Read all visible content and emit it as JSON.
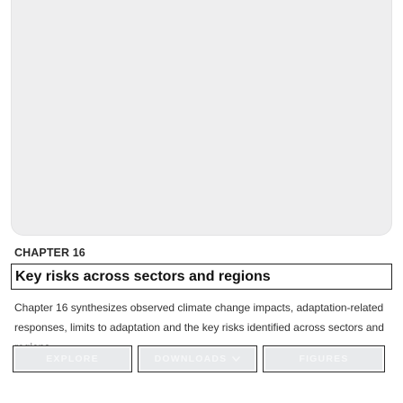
{
  "chapter": {
    "eyebrow": "CHAPTER 16",
    "title": "Key risks across sectors and regions",
    "description": "Chapter 16 synthesizes observed climate change impacts, adaptation-related responses, limits to adaptation and the key risks identified across sectors and regions."
  },
  "actions": {
    "explore_label": "EXPLORE",
    "downloads_label": "DOWNLOADS",
    "figures_label": "FIGURES"
  },
  "icons": {
    "downloads_dropdown": "chevron-down-icon"
  },
  "colors": {
    "hero_background": "#eeeeef",
    "button_background": "#e8eaec",
    "button_text": "#f6f7f8"
  }
}
